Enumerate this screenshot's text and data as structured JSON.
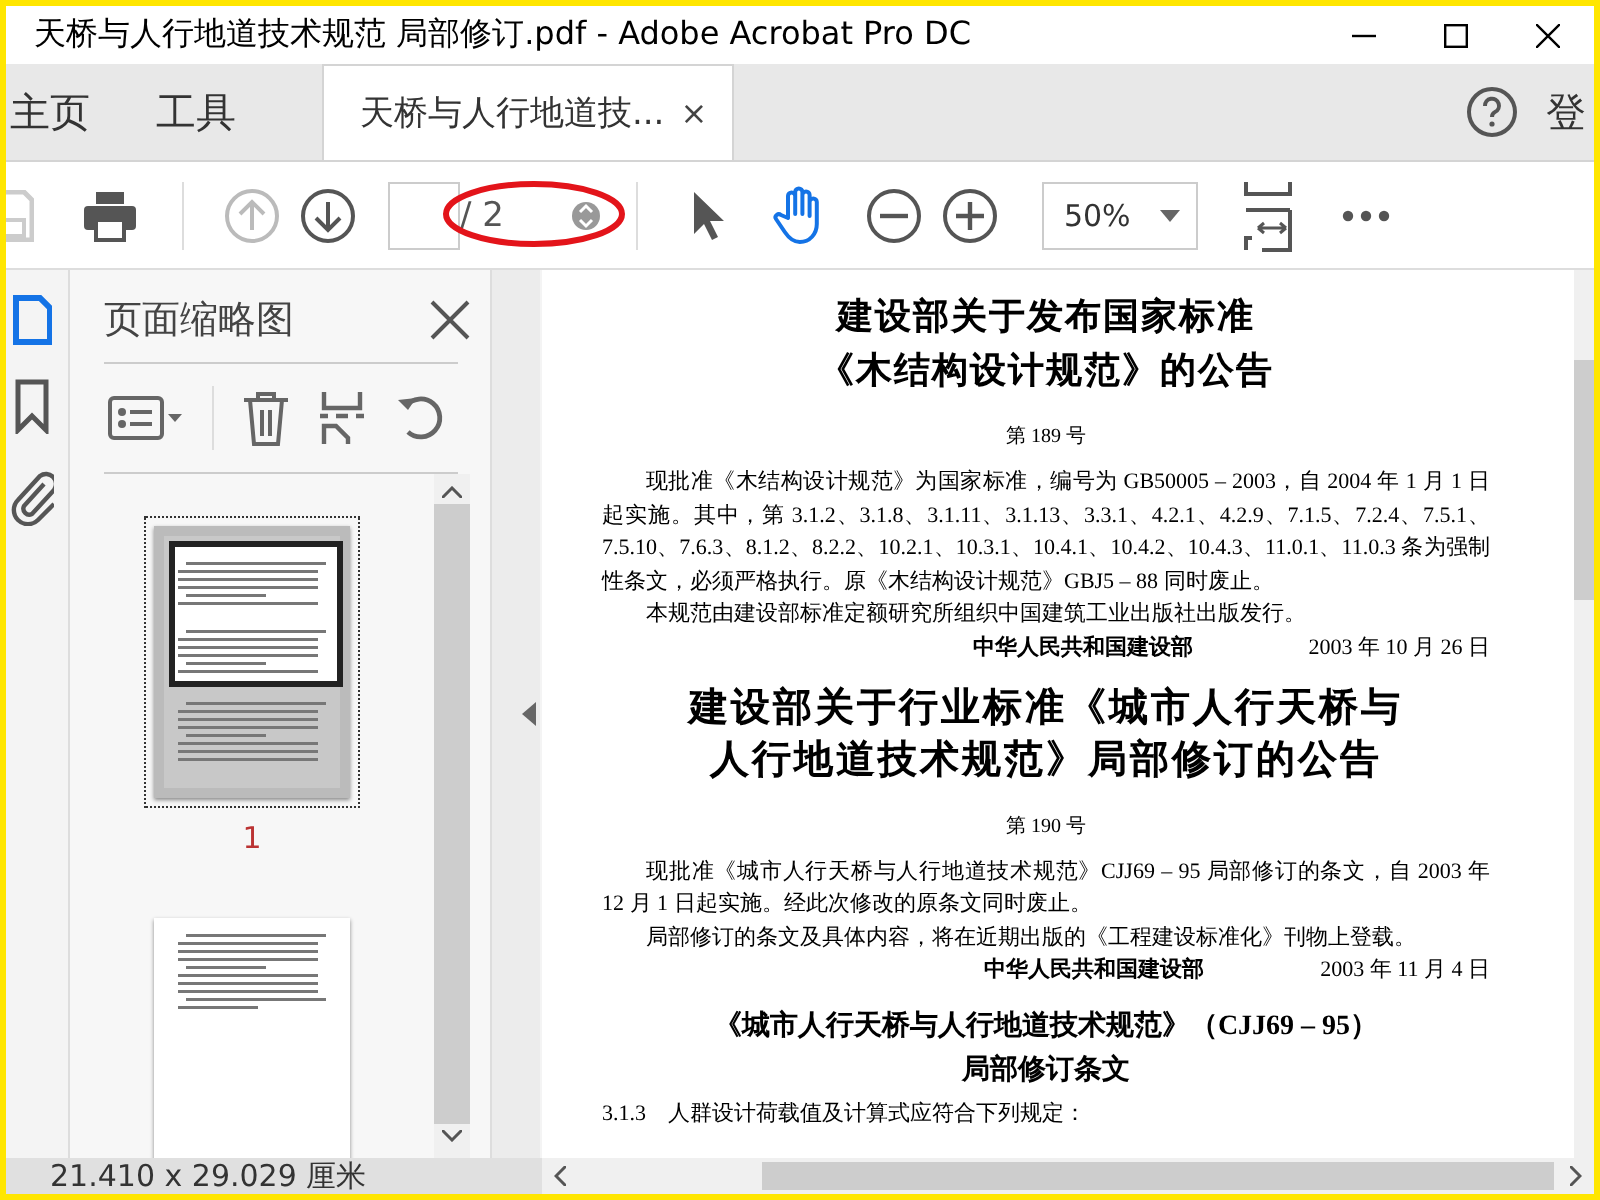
{
  "window": {
    "title": "天桥与人行地道技术规范 局部修订.pdf - Adobe Acrobat Pro DC"
  },
  "tabs": [
    {
      "label": "主页",
      "selected": false
    },
    {
      "label": "工具",
      "selected": false
    },
    {
      "label": "天桥与人行地道技...",
      "selected": true,
      "close": "×"
    }
  ],
  "account": {
    "sign_in": "登"
  },
  "toolbar": {
    "save_disabled": true,
    "prev_disabled": true,
    "next_disabled": false,
    "page_total": "/ 2",
    "zoom": "50%",
    "tools": [
      {
        "kind": "pointer",
        "selected": false
      },
      {
        "kind": "hand",
        "selected": true
      }
    ]
  },
  "thumbnails_panel": {
    "title": "页面缩略图",
    "pages": [
      {
        "label": "1",
        "selected": true
      },
      {
        "selected": false
      }
    ]
  },
  "document": {
    "sections": [
      {
        "title": [
          "建设部关于发布国家标准",
          "《木结构设计规范》的公告"
        ],
        "number": "第 189 号",
        "paragraphs": [
          "现批准《木结构设计规范》为国家标准，编号为 GB50005 – 2003，自 2004 年 1 月 1 日起实施。其中，第 3.1.2、3.1.8、3.1.11、3.1.13、3.3.1、4.2.1、4.2.9、7.1.5、7.2.4、7.5.1、7.5.10、7.6.3、8.1.2、8.2.2、10.2.1、10.3.1、10.4.1、10.4.2、10.4.3、11.0.1、11.0.3 条为强制性条文，必须严格执行。原《木结构设计规范》GBJ5 – 88 同时废止。",
          "本规范由建设部标准定额研究所组织中国建筑工业出版社出版发行。"
        ],
        "signature": "中华人民共和国建设部",
        "date": "2003 年 10 月 26 日"
      },
      {
        "title": [
          "建设部关于行业标准《城市人行天桥与",
          "人行地道技术规范》局部修订的公告"
        ],
        "number": "第 190 号",
        "paragraphs": [
          "现批准《城市人行天桥与人行地道技术规范》CJJ69 – 95 局部修订的条文，自 2003 年 12 月 1 日起实施。经此次修改的原条文同时废止。",
          "局部修订的条文及具体内容，将在近期出版的《工程建设标准化》刊物上登载。"
        ],
        "signature": "中华人民共和国建设部",
        "date": "2003 年 11 月 4 日"
      }
    ],
    "clause_title": [
      "《城市人行天桥与人行地道技术规范》（CJJ69 – 95）",
      "局部修订条文"
    ],
    "clause": "3.1.3　人群设计荷载值及计算式应符合下列规定："
  },
  "status_bar": {
    "page_size": "21.410 x 29.029 厘米"
  }
}
